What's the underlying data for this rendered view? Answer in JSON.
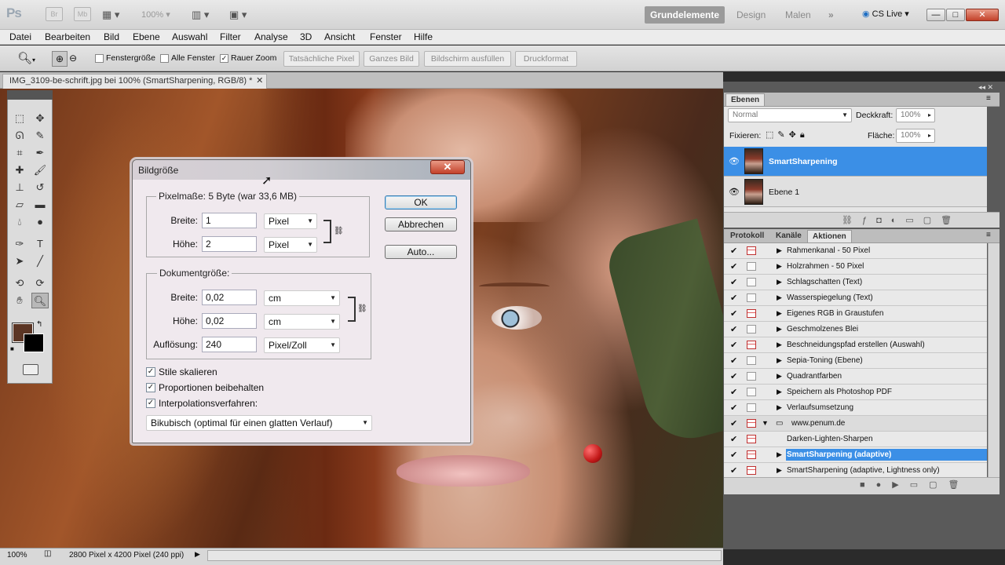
{
  "app": {
    "logo": "Ps",
    "br": "Br",
    "mb": "Mb",
    "zoom": "100%",
    "cslive": "CS Live",
    "min": "—",
    "max": "□",
    "close": "✕"
  },
  "workspaces": [
    "Grundelemente",
    "Design",
    "Malen",
    "»"
  ],
  "menu": [
    "Datei",
    "Bearbeiten",
    "Bild",
    "Ebene",
    "Auswahl",
    "Filter",
    "Analyse",
    "3D",
    "Ansicht",
    "Fenster",
    "Hilfe"
  ],
  "options": {
    "cb1": "Fenstergröße",
    "cb2": "Alle Fenster",
    "cb3": "Rauer Zoom",
    "btn1": "Tatsächliche Pixel",
    "btn2": "Ganzes Bild",
    "btn3": "Bildschirm ausfüllen",
    "btn4": "Druckformat"
  },
  "doc": {
    "tab": "IMG_3109-be-schrift.jpg bei 100% (SmartSharpening, RGB/8) *",
    "close": "✕"
  },
  "dialog": {
    "title": "Bildgröße",
    "close": "✕",
    "pixel_group": "Pixelmaße: 5 Byte (war 33,6 MB)",
    "width_label": "Breite:",
    "height_label": "Höhe:",
    "px_width": "1",
    "px_height": "2",
    "px_unit": "Pixel",
    "doc_group": "Dokumentgröße:",
    "doc_width": "0,02",
    "doc_height": "0,02",
    "doc_unit": "cm",
    "res_label": "Auflösung:",
    "res": "240",
    "res_unit": "Pixel/Zoll",
    "ok": "OK",
    "cancel": "Abbrechen",
    "auto": "Auto...",
    "cb_styles": "Stile skalieren",
    "cb_prop": "Proportionen beibehalten",
    "cb_interp": "Interpolationsverfahren:",
    "interp": "Bikubisch (optimal für einen glatten Verlauf)"
  },
  "layers": {
    "tab": "Ebenen",
    "blend": "Normal",
    "opacity_label": "Deckkraft:",
    "opacity": "100%",
    "lock_label": "Fixieren:",
    "fill_label": "Fläche:",
    "fill": "100%",
    "items": [
      {
        "name": "SmartSharpening"
      },
      {
        "name": "Ebene 1"
      }
    ]
  },
  "actions": {
    "tabs": [
      "Protokoll",
      "Kanäle",
      "Aktionen"
    ],
    "items": [
      {
        "name": "Rahmenkanal - 50 Pixel"
      },
      {
        "name": "Holzrahmen - 50 Pixel"
      },
      {
        "name": "Schlagschatten (Text)"
      },
      {
        "name": "Wasserspiegelung (Text)"
      },
      {
        "name": "Eigenes RGB in Graustufen"
      },
      {
        "name": "Geschmolzenes Blei"
      },
      {
        "name": "Beschneidungspfad erstellen (Auswahl)"
      },
      {
        "name": "Sepia-Toning (Ebene)"
      },
      {
        "name": "Quadrantfarben"
      },
      {
        "name": "Speichern als Photoshop PDF"
      },
      {
        "name": "Verlaufsumsetzung"
      },
      {
        "name": "www.penum.de"
      },
      {
        "name": "Darken-Lighten-Sharpen"
      },
      {
        "name": "SmartSharpening (adaptive)"
      },
      {
        "name": "SmartSharpening (adaptive, Lightness only)"
      }
    ]
  },
  "status": {
    "zoom": "100%",
    "info": "2800 Pixel x 4200 Pixel (240 ppi)"
  }
}
